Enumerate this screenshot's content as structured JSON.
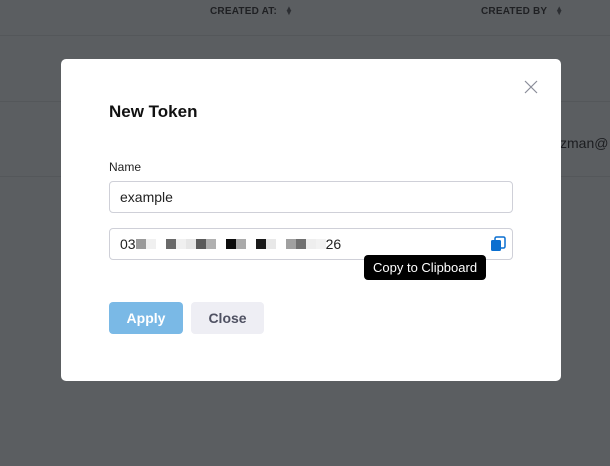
{
  "table": {
    "headers": [
      "CREATED AT:",
      "CREATED BY"
    ],
    "row_email_fragment": "zman@"
  },
  "modal": {
    "title": "New Token",
    "name_label": "Name",
    "name_value": "example",
    "token_prefix": "03",
    "token_suffix": "26",
    "copy_tooltip": "Copy to Clipboard",
    "apply_label": "Apply",
    "close_label": "Close"
  },
  "colors": {
    "accent": "#0a6fd0",
    "apply_bg": "#7ab9e6",
    "overlay": "#5b5e61"
  }
}
